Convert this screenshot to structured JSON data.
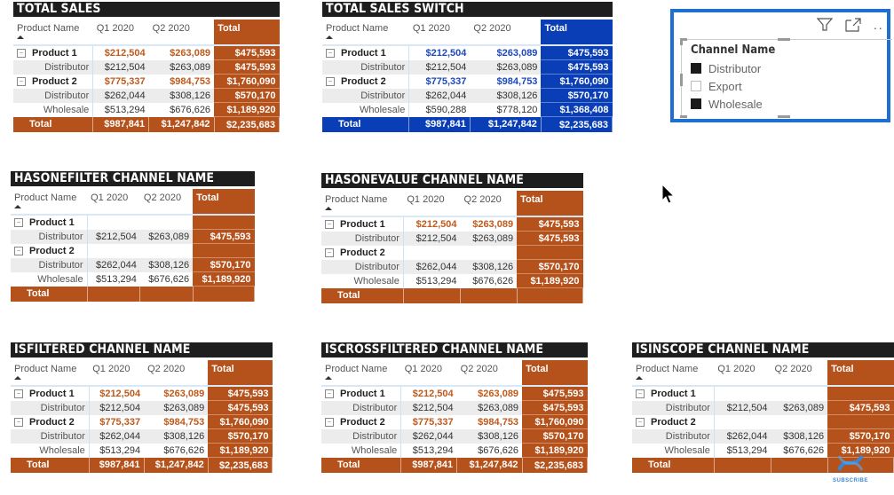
{
  "matrices": [
    {
      "id": "total-sales",
      "title": "TOTAL SALES",
      "theme": "orange",
      "headers": [
        "Product Name",
        "Q1 2020",
        "Q2 2020",
        "Total"
      ],
      "rows": [
        {
          "type": "group",
          "label": "Product 1",
          "q1": "$212,504",
          "q2": "$263,089",
          "total": "$475,593"
        },
        {
          "type": "child",
          "label": "Distributor",
          "q1": "$212,504",
          "q2": "$263,089",
          "total": "$475,593"
        },
        {
          "type": "group",
          "label": "Product 2",
          "q1": "$775,337",
          "q2": "$984,753",
          "total": "$1,760,090"
        },
        {
          "type": "child",
          "label": "Distributor",
          "q1": "$262,044",
          "q2": "$308,126",
          "total": "$570,170"
        },
        {
          "type": "child",
          "label": "Wholesale",
          "q1": "$513,294",
          "q2": "$676,626",
          "total": "$1,189,920"
        }
      ],
      "total": {
        "label": "Total",
        "q1": "$987,841",
        "q2": "$1,247,842",
        "total": "$2,235,683"
      }
    },
    {
      "id": "total-sales-switch",
      "title": "TOTAL SALES SWITCH",
      "theme": "blue",
      "headers": [
        "Product Name",
        "Q1 2020",
        "Q2 2020",
        "Total"
      ],
      "rows": [
        {
          "type": "group",
          "label": "Product 1",
          "q1": "$212,504",
          "q2": "$263,089",
          "total": "$475,593"
        },
        {
          "type": "child",
          "label": "Distributor",
          "q1": "$212,504",
          "q2": "$263,089",
          "total": "$475,593"
        },
        {
          "type": "group",
          "label": "Product 2",
          "q1": "$775,337",
          "q2": "$984,753",
          "total": "$1,760,090"
        },
        {
          "type": "child",
          "label": "Distributor",
          "q1": "$262,044",
          "q2": "$308,126",
          "total": "$570,170"
        },
        {
          "type": "child",
          "label": "Wholesale",
          "q1": "$590,288",
          "q2": "$778,120",
          "total": "$1,368,408"
        }
      ],
      "total": {
        "label": "Total",
        "q1": "$987,841",
        "q2": "$1,247,842",
        "total": "$2,235,683"
      }
    },
    {
      "id": "hasonefilter",
      "title": "HASONEFILTER CHANNEL NAME",
      "theme": "orange",
      "headers": [
        "Product Name",
        "Q1 2020",
        "Q2 2020",
        "Total"
      ],
      "rows": [
        {
          "type": "group",
          "label": "Product 1",
          "q1": "",
          "q2": "",
          "total": ""
        },
        {
          "type": "child",
          "label": "Distributor",
          "q1": "$212,504",
          "q2": "$263,089",
          "total": "$475,593"
        },
        {
          "type": "group",
          "label": "Product 2",
          "q1": "",
          "q2": "",
          "total": ""
        },
        {
          "type": "child",
          "label": "Distributor",
          "q1": "$262,044",
          "q2": "$308,126",
          "total": "$570,170"
        },
        {
          "type": "child",
          "label": "Wholesale",
          "q1": "$513,294",
          "q2": "$676,626",
          "total": "$1,189,920"
        }
      ],
      "total": {
        "label": "Total",
        "q1": "",
        "q2": "",
        "total": ""
      }
    },
    {
      "id": "hasonevalue",
      "title": "HASONEVALUE CHANNEL NAME",
      "theme": "orange",
      "headers": [
        "Product Name",
        "Q1 2020",
        "Q2 2020",
        "Total"
      ],
      "rows": [
        {
          "type": "group",
          "label": "Product 1",
          "q1": "$212,504",
          "q2": "$263,089",
          "total": "$475,593"
        },
        {
          "type": "child",
          "label": "Distributor",
          "q1": "$212,504",
          "q2": "$263,089",
          "total": "$475,593"
        },
        {
          "type": "group",
          "label": "Product 2",
          "q1": "",
          "q2": "",
          "total": ""
        },
        {
          "type": "child",
          "label": "Distributor",
          "q1": "$262,044",
          "q2": "$308,126",
          "total": "$570,170"
        },
        {
          "type": "child",
          "label": "Wholesale",
          "q1": "$513,294",
          "q2": "$676,626",
          "total": "$1,189,920"
        }
      ],
      "total": {
        "label": "Total",
        "q1": "",
        "q2": "",
        "total": ""
      }
    },
    {
      "id": "isfiltered",
      "title": "ISFILTERED CHANNEL NAME",
      "theme": "orange",
      "headers": [
        "Product Name",
        "Q1 2020",
        "Q2 2020",
        "Total"
      ],
      "rows": [
        {
          "type": "group",
          "label": "Product 1",
          "q1": "$212,504",
          "q2": "$263,089",
          "total": "$475,593"
        },
        {
          "type": "child",
          "label": "Distributor",
          "q1": "$212,504",
          "q2": "$263,089",
          "total": "$475,593"
        },
        {
          "type": "group",
          "label": "Product 2",
          "q1": "$775,337",
          "q2": "$984,753",
          "total": "$1,760,090"
        },
        {
          "type": "child",
          "label": "Distributor",
          "q1": "$262,044",
          "q2": "$308,126",
          "total": "$570,170"
        },
        {
          "type": "child",
          "label": "Wholesale",
          "q1": "$513,294",
          "q2": "$676,626",
          "total": "$1,189,920"
        }
      ],
      "total": {
        "label": "Total",
        "q1": "$987,841",
        "q2": "$1,247,842",
        "total": "$2,235,683"
      }
    },
    {
      "id": "iscrossfiltered",
      "title": "ISCROSSFILTERED CHANNEL NAME",
      "theme": "orange",
      "headers": [
        "Product Name",
        "Q1 2020",
        "Q2 2020",
        "Total"
      ],
      "rows": [
        {
          "type": "group",
          "label": "Product 1",
          "q1": "$212,504",
          "q2": "$263,089",
          "total": "$475,593"
        },
        {
          "type": "child",
          "label": "Distributor",
          "q1": "$212,504",
          "q2": "$263,089",
          "total": "$475,593"
        },
        {
          "type": "group",
          "label": "Product 2",
          "q1": "$775,337",
          "q2": "$984,753",
          "total": "$1,760,090"
        },
        {
          "type": "child",
          "label": "Distributor",
          "q1": "$262,044",
          "q2": "$308,126",
          "total": "$570,170"
        },
        {
          "type": "child",
          "label": "Wholesale",
          "q1": "$513,294",
          "q2": "$676,626",
          "total": "$1,189,920"
        }
      ],
      "total": {
        "label": "Total",
        "q1": "$987,841",
        "q2": "$1,247,842",
        "total": "$2,235,683"
      }
    },
    {
      "id": "isinscope",
      "title": "ISINSCOPE CHANNEL NAME",
      "theme": "orange",
      "headers": [
        "Product Name",
        "Q1 2020",
        "Q2 2020",
        "Total"
      ],
      "rows": [
        {
          "type": "group",
          "label": "Product 1",
          "q1": "",
          "q2": "",
          "total": ""
        },
        {
          "type": "child",
          "label": "Distributor",
          "q1": "$212,504",
          "q2": "$263,089",
          "total": "$475,593"
        },
        {
          "type": "group",
          "label": "Product 2",
          "q1": "",
          "q2": "",
          "total": ""
        },
        {
          "type": "child",
          "label": "Distributor",
          "q1": "$262,044",
          "q2": "$308,126",
          "total": "$570,170"
        },
        {
          "type": "child",
          "label": "Wholesale",
          "q1": "$513,294",
          "q2": "$676,626",
          "total": "$1,189,920"
        }
      ],
      "total": {
        "label": "Total",
        "q1": "",
        "q2": "",
        "total": ""
      }
    }
  ],
  "slicer": {
    "title": "Channel Name",
    "items": [
      {
        "label": "Distributor",
        "selected": true
      },
      {
        "label": "Export",
        "selected": false
      },
      {
        "label": "Wholesale",
        "selected": true
      }
    ],
    "icons": [
      "filter-icon",
      "focus-mode-icon",
      "more-options-icon"
    ],
    "accent": "#1e6fd1"
  },
  "colors": {
    "orange": "#b5511a",
    "blue": "#0a3eb6",
    "title_bar": "#1e1e1e"
  },
  "subscribe": {
    "label": "SUBSCRIBE"
  }
}
